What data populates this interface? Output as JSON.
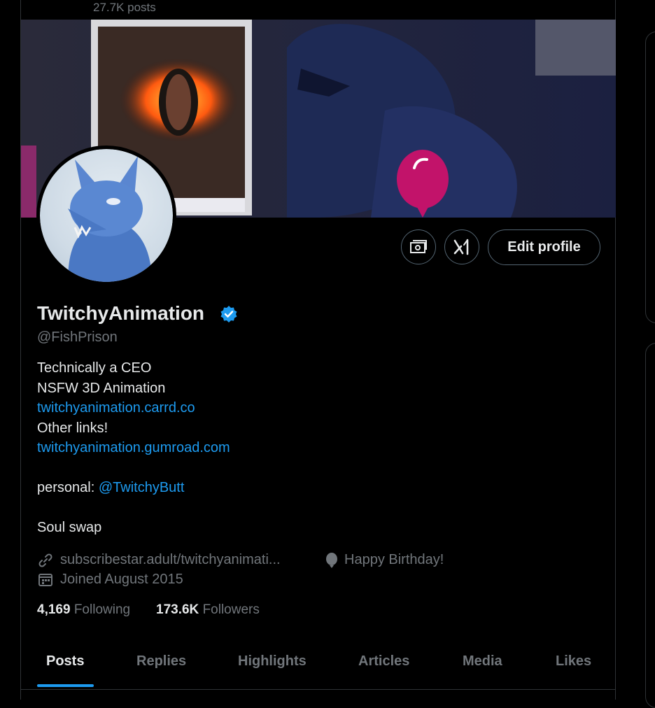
{
  "header": {
    "post_count": "27.7K posts"
  },
  "profile": {
    "display_name": "TwitchyAnimation",
    "handle": "@FishPrison",
    "verified": true,
    "bio_lines": [
      "Technically a CEO",
      "NSFW 3D Animation",
      "twitchyanimation.carrd.co",
      "Other links!",
      "twitchyanimation.gumroad.com"
    ],
    "personal_label": "personal:",
    "personal_handle": "@TwitchyButt",
    "last_line": "Soul swap",
    "website": "subscribestar.adult/twitchyanimati...",
    "birthday": "Happy Birthday!",
    "joined": "Joined August 2015",
    "following_count": "4,169",
    "following_label": "Following",
    "followers_count": "173.6K",
    "followers_label": "Followers"
  },
  "actions": {
    "subscriptions_icon": "money-icon",
    "grok_icon": "grok-icon",
    "edit_label": "Edit profile"
  },
  "tabs": [
    {
      "label": "Posts",
      "active": true
    },
    {
      "label": "Replies"
    },
    {
      "label": "Highlights"
    },
    {
      "label": "Articles"
    },
    {
      "label": "Media"
    },
    {
      "label": "Likes"
    }
  ],
  "colors": {
    "accent": "#1d9bf0",
    "balloon": "#c2136a",
    "background": "#000000"
  }
}
